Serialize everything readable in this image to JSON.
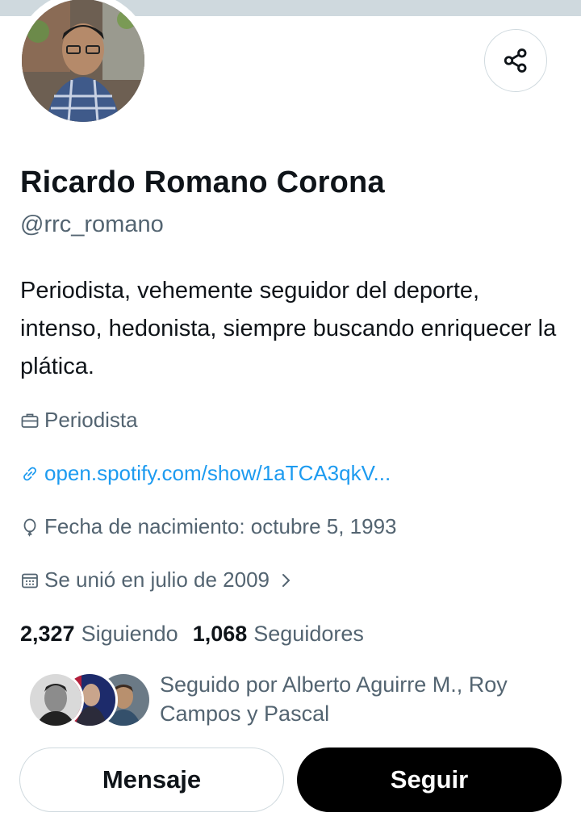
{
  "profile": {
    "name": "Ricardo Romano Corona",
    "handle": "@rrc_romano",
    "bio": "Periodista, vehemente seguidor del deporte, intenso, hedonista, siempre buscando enriquecer la plática.",
    "profession": "Periodista",
    "link": "open.spotify.com/show/1aTCA3qkV...",
    "birthdate": "Fecha de nacimiento: octubre 5, 1993",
    "joined": "Se unió en julio de 2009"
  },
  "stats": {
    "following_count": "2,327",
    "following_label": "Siguiendo",
    "followers_count": "1,068",
    "followers_label": "Seguidores"
  },
  "followed_by": "Seguido por Alberto Aguirre M., Roy Campos y Pascal",
  "actions": {
    "message": "Mensaje",
    "follow": "Seguir"
  },
  "icons": {
    "share": "share-icon",
    "profession": "briefcase-icon",
    "link": "link-icon",
    "birth": "balloon-icon",
    "joined": "calendar-icon",
    "chevron": "chevron-right-icon"
  },
  "colors": {
    "link": "#1d9bf0",
    "secondary_text": "#536471",
    "primary_text": "#0f1419",
    "follow_button": "#000000"
  }
}
